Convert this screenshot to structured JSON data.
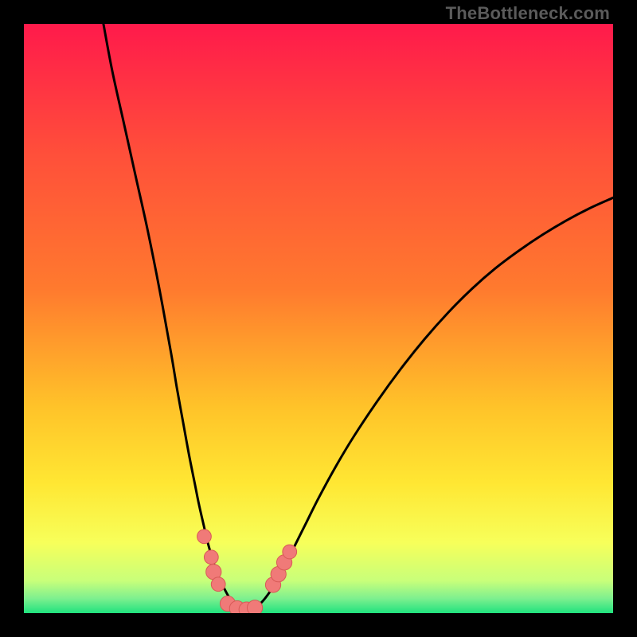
{
  "watermark": "TheBottleneck.com",
  "colors": {
    "gradient_top": "#ff1a4b",
    "gradient_upper_mid": "#ff7a2e",
    "gradient_mid": "#ffe733",
    "gradient_lower": "#f7ff5a",
    "gradient_near_bottom": "#c8ff7a",
    "gradient_bottom": "#20e27e",
    "curve": "#000000",
    "marker_fill": "#f07a78",
    "marker_stroke": "#d85a57",
    "frame": "#000000"
  },
  "chart_data": {
    "type": "line",
    "title": "",
    "xlabel": "",
    "ylabel": "",
    "xlim": [
      0,
      100
    ],
    "ylim": [
      0,
      100
    ],
    "series": [
      {
        "name": "left-branch",
        "x": [
          13.5,
          15,
          17,
          19,
          21,
          23,
          25,
          26,
          27,
          28,
          29,
          29.7,
          30.5,
          31.2,
          32,
          32.7,
          33.5,
          34.2,
          35,
          37
        ],
        "y": [
          100,
          92,
          83,
          74,
          65,
          55,
          44,
          38,
          32.5,
          27,
          22,
          18.5,
          15,
          12,
          9.2,
          7,
          5.2,
          3.8,
          2.5,
          0.5
        ]
      },
      {
        "name": "valley-floor",
        "x": [
          35,
          36,
          37,
          38,
          39,
          40
        ],
        "y": [
          2.5,
          1.0,
          0.5,
          0.5,
          0.8,
          1.5
        ]
      },
      {
        "name": "right-branch",
        "x": [
          38,
          40,
          42,
          44,
          46,
          48,
          50,
          53,
          56,
          60,
          64,
          68,
          72,
          76,
          80,
          84,
          88,
          92,
          96,
          100
        ],
        "y": [
          0.5,
          1.5,
          4.0,
          7.5,
          11.5,
          15.5,
          19.5,
          25,
          30,
          36,
          41.5,
          46.5,
          51,
          55,
          58.5,
          61.5,
          64.2,
          66.6,
          68.7,
          70.5
        ]
      }
    ],
    "markers": [
      {
        "x": 30.6,
        "y": 13.0,
        "r": 1.2
      },
      {
        "x": 31.8,
        "y": 9.5,
        "r": 1.2
      },
      {
        "x": 32.2,
        "y": 7.0,
        "r": 1.3
      },
      {
        "x": 33.0,
        "y": 4.9,
        "r": 1.2
      },
      {
        "x": 34.6,
        "y": 1.6,
        "r": 1.3
      },
      {
        "x": 36.2,
        "y": 0.8,
        "r": 1.3
      },
      {
        "x": 37.8,
        "y": 0.6,
        "r": 1.3
      },
      {
        "x": 39.2,
        "y": 0.9,
        "r": 1.3
      },
      {
        "x": 42.3,
        "y": 4.8,
        "r": 1.3
      },
      {
        "x": 43.2,
        "y": 6.6,
        "r": 1.3
      },
      {
        "x": 44.2,
        "y": 8.6,
        "r": 1.3
      },
      {
        "x": 45.1,
        "y": 10.4,
        "r": 1.2
      }
    ]
  }
}
